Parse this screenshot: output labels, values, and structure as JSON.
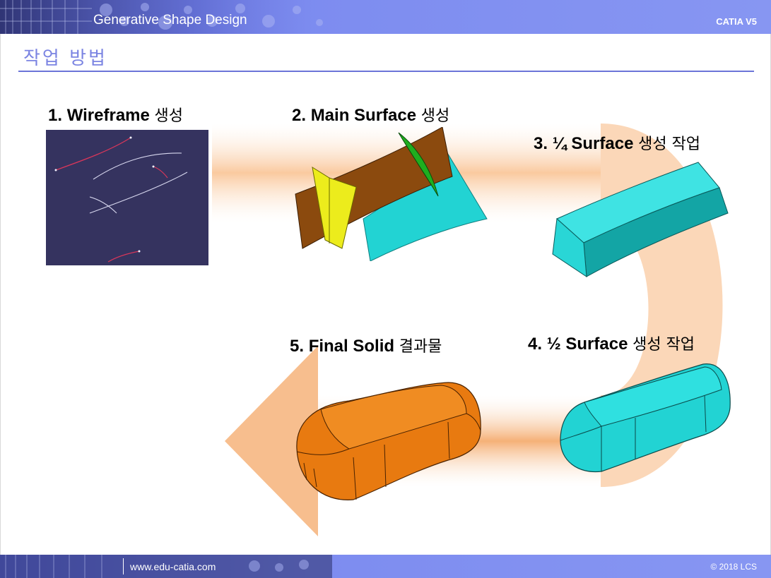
{
  "header": {
    "title": "Generative Shape Design",
    "brand": "CATIA V5"
  },
  "section": {
    "title": "작업 방법"
  },
  "steps": [
    {
      "num": "1.",
      "name": "Wireframe",
      "suffix": "생성"
    },
    {
      "num": "2.",
      "name": "Main Surface",
      "suffix": "생성"
    },
    {
      "num": "3.",
      "name": "¼ Surface",
      "suffix": "생성 작업"
    },
    {
      "num": "4.",
      "name": "½ Surface",
      "suffix": "생성 작업"
    },
    {
      "num": "5.",
      "name": "Final Solid",
      "suffix": "결과물"
    }
  ],
  "footer": {
    "url": "www.edu-catia.com",
    "copyright": "© 2018 LCS"
  },
  "colors": {
    "header_band": "#7d8cf0",
    "accent_title": "#7b84e2",
    "flow_arrow": "#f6b27a",
    "wire_bg": "#35335f",
    "surface_brown": "#8b4a0e",
    "surface_yellow": "#ecec1c",
    "surface_cyan": "#22d3d3",
    "solid_orange": "#e87a10"
  },
  "icons": [
    "flow-arrow-icon",
    "header-circuit-pattern-icon"
  ]
}
